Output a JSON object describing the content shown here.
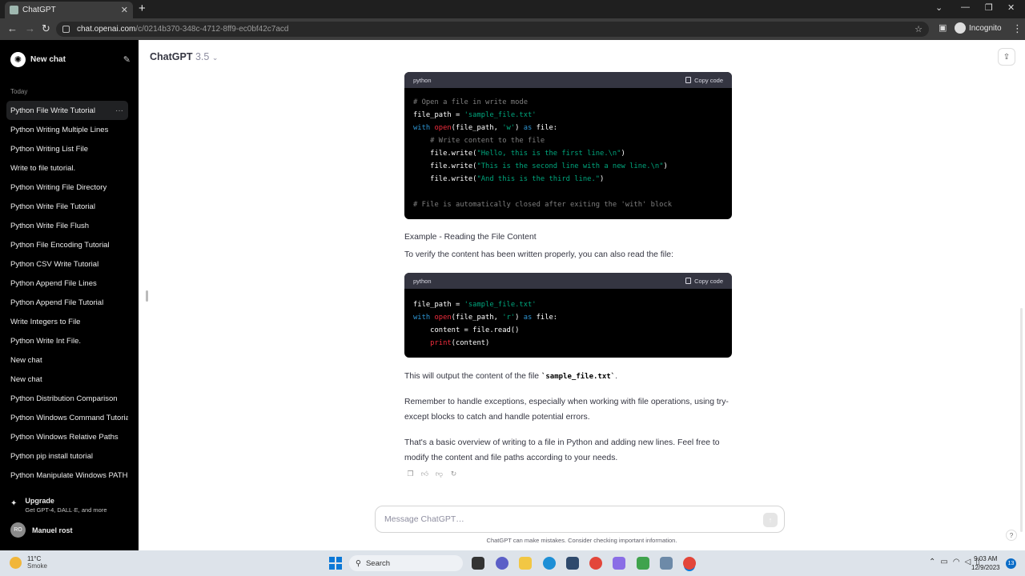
{
  "browser": {
    "tab_title": "ChatGPT",
    "url_domain": "chat.openai.com",
    "url_path": "/c/0214b370-348c-4712-8ff9-ec0bf42c7acd",
    "incognito_label": "Incognito"
  },
  "sidebar": {
    "new_chat": "New chat",
    "section_today": "Today",
    "history": [
      "Python File Write Tutorial",
      "Python Writing Multiple Lines",
      "Python Writing List File",
      "Write to file tutorial.",
      "Python Writing File Directory",
      "Python Write File Tutorial",
      "Python Write File Flush",
      "Python File Encoding Tutorial",
      "Python CSV Write Tutorial",
      "Python Append File Lines",
      "Python Append File Tutorial",
      "Write Integers to File",
      "Python Write Int File.",
      "New chat",
      "New chat",
      "Python Distribution Comparison",
      "Python Windows Command Tutorial",
      "Python Windows Relative Paths",
      "Python pip install tutorial",
      "Python Manipulate Windows PATH"
    ],
    "upgrade_title": "Upgrade",
    "upgrade_sub": "Get GPT-4, DALL·E, and more",
    "user_initials": "RO",
    "user_name": "Manuel rost"
  },
  "header": {
    "model": "ChatGPT",
    "version": "3.5"
  },
  "conversation": {
    "code1": {
      "lang": "python",
      "copy_label": "Copy code",
      "lines": [
        [
          [
            "c-com",
            "# Open a file in write mode"
          ]
        ],
        [
          [
            "c-op",
            "file_path = "
          ],
          [
            "c-str",
            "'sample_file.txt'"
          ]
        ],
        [
          [
            "c-kw",
            "with "
          ],
          [
            "c-fn",
            "open"
          ],
          [
            "c-op",
            "(file_path, "
          ],
          [
            "c-str",
            "'w'"
          ],
          [
            "c-op",
            ") "
          ],
          [
            "c-kw",
            "as"
          ],
          [
            "c-op",
            " file:"
          ]
        ],
        [
          [
            "c-com",
            "    # Write content to the file"
          ]
        ],
        [
          [
            "c-op",
            "    file.write("
          ],
          [
            "c-str",
            "\"Hello, this is the first line.\\n\""
          ],
          [
            "c-op",
            ")"
          ]
        ],
        [
          [
            "c-op",
            "    file.write("
          ],
          [
            "c-str",
            "\"This is the second line with a new line.\\n\""
          ],
          [
            "c-op",
            ")"
          ]
        ],
        [
          [
            "c-op",
            "    file.write("
          ],
          [
            "c-str",
            "\"And this is the third line.\""
          ],
          [
            "c-op",
            ")"
          ]
        ],
        [],
        [
          [
            "c-com",
            "# File is automatically closed after exiting the 'with' block"
          ]
        ]
      ]
    },
    "heading2": "Example - Reading the File Content",
    "para1": "To verify the content has been written properly, you can also read the file:",
    "code2": {
      "lang": "python",
      "copy_label": "Copy code",
      "lines": [
        [
          [
            "c-op",
            "file_path = "
          ],
          [
            "c-str",
            "'sample_file.txt'"
          ]
        ],
        [
          [
            "c-kw",
            "with "
          ],
          [
            "c-fn",
            "open"
          ],
          [
            "c-op",
            "(file_path, "
          ],
          [
            "c-str",
            "'r'"
          ],
          [
            "c-op",
            ") "
          ],
          [
            "c-kw",
            "as"
          ],
          [
            "c-op",
            " file:"
          ]
        ],
        [
          [
            "c-op",
            "    content = file.read()"
          ]
        ],
        [
          [
            "c-fn",
            "    print"
          ],
          [
            "c-op",
            "(content)"
          ]
        ]
      ]
    },
    "para2_prefix": "This will output the content of the file ",
    "para2_code": "`sample_file.txt`",
    "para2_suffix": ".",
    "para3": "Remember to handle exceptions, especially when working with file operations, using try-except blocks to catch and handle potential errors.",
    "para4": "That's a basic overview of writing to a file in Python and adding new lines. Feel free to modify the content and file paths according to your needs."
  },
  "composer": {
    "placeholder": "Message ChatGPT…",
    "disclaimer": "ChatGPT can make mistakes. Consider checking important information."
  },
  "taskbar": {
    "temp": "11°C",
    "condition": "Smoke",
    "search_label": "Search",
    "time": "9:03 AM",
    "date": "12/9/2023",
    "notifications": "13"
  }
}
